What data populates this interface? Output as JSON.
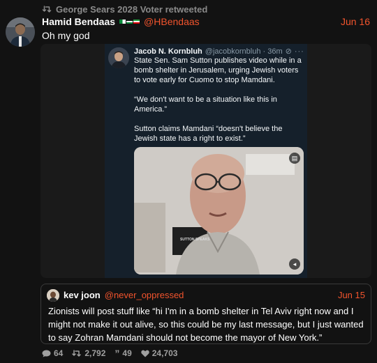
{
  "retweet": {
    "icon": "retweet-icon",
    "label": "George Sears 2028 Voter retweeted"
  },
  "tweet": {
    "display_name": "Hamid Bendaas",
    "flags": [
      "algeria-flag-icon",
      "palestine-flag-icon",
      "iran-flag-icon"
    ],
    "handle": "@HBendaas",
    "date": "Jun 16",
    "text": "Oh my god",
    "accent_color": "#f2542d"
  },
  "embedded_post": {
    "name": "Jacob N. Kornbluh",
    "handle": "@jacobkornbluh · 36m",
    "paragraphs": [
      "State Sen. Sam Sutton publishes video while in a bomb shelter in Jerusalem, urging Jewish voters to vote early for Cuomo to stop Mamdani.",
      "“We don't want to be a situation like this in America.”",
      "Sutton claims Mamdani “doesn't believe the Jewish state has a right to exist.”"
    ],
    "video_caption": "SUTTON SPEAKS"
  },
  "quote": {
    "name": "kev joon",
    "handle": "@never_oppressed",
    "date": "Jun 15",
    "text": "Zionists will post stuff like “hi I'm in a bomb shelter in Tel Aviv right now and I might not make it out alive, so this could be my last message, but I just wanted to say Zohran Mamdani should not become the mayor of New York.”"
  },
  "stats": {
    "replies": "64",
    "retweets": "2,792",
    "quotes": "49",
    "likes": "24,703"
  }
}
